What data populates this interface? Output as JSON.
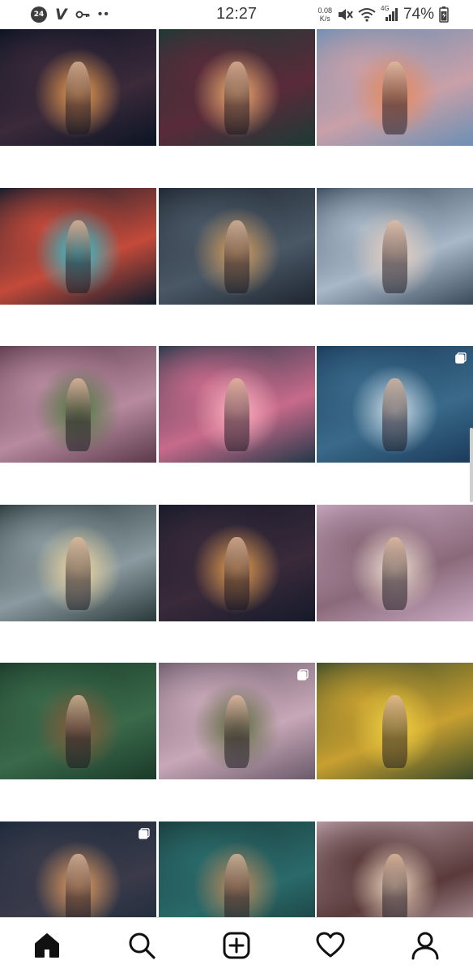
{
  "status_bar": {
    "badge": "24",
    "time": "12:27",
    "net_speed_value": "0.08",
    "net_speed_unit": "K/s",
    "network": "4G",
    "battery": "74%",
    "icons": [
      "v-app-icon",
      "key-icon",
      "mute-icon",
      "wifi-icon",
      "signal-icon",
      "battery-icon"
    ]
  },
  "grid": {
    "columns": 3,
    "rows": 6,
    "tiles": [
      {
        "subject": "sparkler couple",
        "colors": [
          "#0b1424",
          "#3b2a3a",
          "#f0a050"
        ]
      },
      {
        "subject": "girl with mirror and fire",
        "colors": [
          "#1c3a34",
          "#5a2a3a",
          "#f4b070"
        ]
      },
      {
        "subject": "dancer leaping at sunset",
        "colors": [
          "#6c8fb4",
          "#c9a0a8",
          "#e8885a"
        ]
      },
      {
        "subject": "girl with neon lights",
        "colors": [
          "#0e1c2c",
          "#c44a3a",
          "#28c8d8"
        ]
      },
      {
        "subject": "dancer on crosswalk",
        "colors": [
          "#1e2630",
          "#4a5866",
          "#d8a060"
        ]
      },
      {
        "subject": "girl with prism rainbow",
        "colors": [
          "#3a4a5a",
          "#a8b8c8",
          "#e8d0c0"
        ]
      },
      {
        "subject": "handstand on bench",
        "colors": [
          "#5a3a4a",
          "#b88aa0",
          "#4a7a3a"
        ]
      },
      {
        "subject": "couple at coffee shop",
        "colors": [
          "#243848",
          "#c86a8a",
          "#ffb0c0"
        ]
      },
      {
        "subject": "girl on pier at dusk",
        "colors": [
          "#1a3a5a",
          "#3a6a8a",
          "#d0e0ea"
        ],
        "multi": true
      },
      {
        "subject": "girl crouching by fence",
        "colors": [
          "#2a3a3a",
          "#8a9aa0",
          "#f0d8a0"
        ]
      },
      {
        "subject": "girl under string lights",
        "colors": [
          "#141a2a",
          "#3a2a3a",
          "#e8a050"
        ]
      },
      {
        "subject": "girl in blossoms",
        "colors": [
          "#c8a8c0",
          "#8a6a7a",
          "#f0e0d0"
        ]
      },
      {
        "subject": "girl in green leaves",
        "colors": [
          "#1a3a2a",
          "#3a6a4a",
          "#8a5a3a"
        ]
      },
      {
        "subject": "backbend under blossom trees",
        "colors": [
          "#6a5a6a",
          "#c8a8b8",
          "#5a6a3a"
        ],
        "multi": true
      },
      {
        "subject": "girl with yellow flowers",
        "colors": [
          "#3a4a2a",
          "#c8a030",
          "#f0d040"
        ]
      },
      {
        "subject": "girl with sparkler in street",
        "colors": [
          "#1a2a3a",
          "#3a3a4a",
          "#e8a060"
        ],
        "multi": true
      },
      {
        "subject": "girl in teal leaves",
        "colors": [
          "#1a3a3a",
          "#2a6a6a",
          "#c08a5a"
        ]
      },
      {
        "subject": "couple under fairy lights",
        "colors": [
          "#b8a0a8",
          "#5a3a3a",
          "#f0d8c0"
        ]
      }
    ]
  },
  "bottom_nav": {
    "items": [
      {
        "name": "home",
        "icon": "home-icon",
        "active": true
      },
      {
        "name": "search",
        "icon": "search-icon"
      },
      {
        "name": "new-post",
        "icon": "add-post-icon"
      },
      {
        "name": "activity",
        "icon": "heart-icon"
      },
      {
        "name": "profile",
        "icon": "profile-icon"
      }
    ]
  }
}
